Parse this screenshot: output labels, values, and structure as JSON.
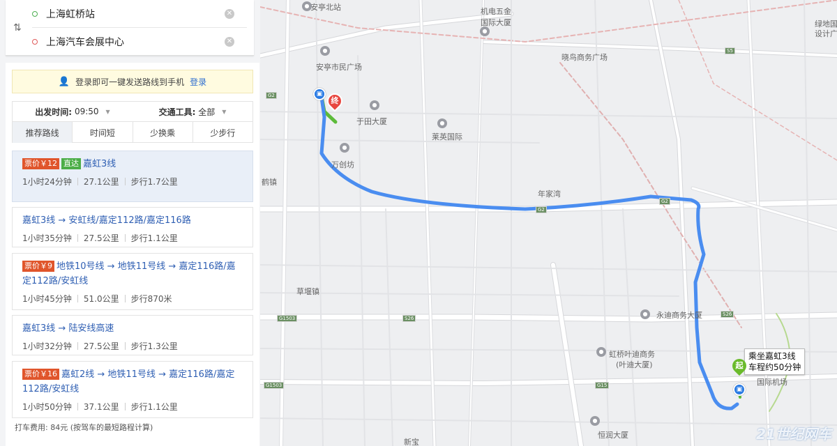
{
  "search": {
    "origin": "上海虹桥站",
    "destination": "上海汽车会展中心",
    "swap_icon": "swap-vertical-icon",
    "clear_icon": "clear-circle-icon"
  },
  "login_prompt": {
    "text": "登录即可一键发送路线到手机",
    "link": "登录",
    "icon": "user-icon"
  },
  "filters": {
    "depart_label": "出发时间:",
    "depart_value": "09:50",
    "transport_label": "交通工具:",
    "transport_value": "全部"
  },
  "tabs": [
    "推荐路线",
    "时间短",
    "少换乘",
    "少步行"
  ],
  "routes": [
    {
      "price": "票价￥12",
      "direct": "直达",
      "title": "嘉虹3线",
      "duration": "1小时24分钟",
      "distance": "27.1公里",
      "walk": "步行1.7公里"
    },
    {
      "price": "",
      "direct": "",
      "title": "嘉虹3线 → 安虹线/嘉定112路/嘉定116路",
      "duration": "1小时35分钟",
      "distance": "27.5公里",
      "walk": "步行1.1公里"
    },
    {
      "price": "票价￥9",
      "direct": "",
      "title": "地铁10号线 → 地铁11号线 → 嘉定116路/嘉定112路/安虹线",
      "duration": "1小时45分钟",
      "distance": "51.0公里",
      "walk": "步行870米"
    },
    {
      "price": "",
      "direct": "",
      "title": "嘉虹3线 → 陆安线高速",
      "duration": "1小时32分钟",
      "distance": "27.5公里",
      "walk": "步行1.3公里"
    },
    {
      "price": "票价￥16",
      "direct": "",
      "title": "嘉虹2线 → 地铁11号线 → 嘉定116路/嘉定112路/安虹线",
      "duration": "1小时50分钟",
      "distance": "37.1公里",
      "walk": "步行1.1公里"
    }
  ],
  "taxi_fare": "打车费用: 84元 (按驾车的最短路程计算)",
  "map": {
    "labels": {
      "anting_north": "安亭北站",
      "jidian": "机电五金",
      "intl_building": "国际大厦",
      "lvdi": "绿地国",
      "design": "设计广",
      "xiaoniao": "晓鸟商务广场",
      "anting_civic": "安亭市民广场",
      "yutian": "于田大厦",
      "laiying": "莱英国际",
      "wanchuang": "万创坊",
      "niangjiawan": "年家湾",
      "he_zhen": "鹤镇",
      "caoyan": "草堰镇",
      "yongdi": "永迪商务大厦",
      "hongqiao_ye": "虹桥叶迪商务",
      "yedi": "(叶迪大厦)",
      "guoji_jichang": "国际机场",
      "hengtian": "恒润大厦",
      "xinbao": "新宝"
    },
    "shields": [
      "G2",
      "G2",
      "G2",
      "S5",
      "G15",
      "G1503",
      "G1503",
      "S26",
      "S26"
    ],
    "callout_line1": "乘坐嘉虹3线",
    "callout_line2": "车程约50分钟",
    "start_marker": "起",
    "end_marker": "终",
    "bus_icon": "bus-icon",
    "watermark": "21世纪网车",
    "route_color": "#4a8df0",
    "walk_color": "#5dbb3a"
  }
}
